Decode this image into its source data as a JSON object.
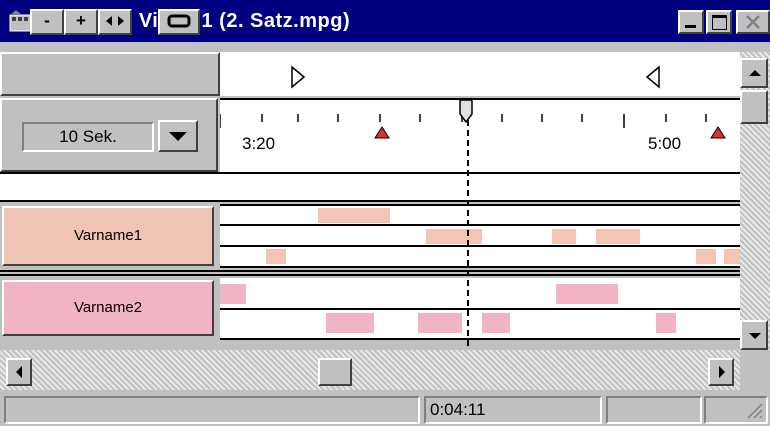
{
  "window": {
    "title": "Timeline Video 1 (2. Satz.mpg)",
    "controls": [
      "minimize-button",
      "maximize-button",
      "close-button"
    ]
  },
  "toolbar": {
    "zoom_out_label": "-",
    "zoom_in_label": "+",
    "fit_label": "◂▸",
    "loop_label": "▭"
  },
  "zoom_select": {
    "value": "10 Sek."
  },
  "ruler": {
    "labels": [
      "3:20",
      "5:00"
    ]
  },
  "tracks": [
    {
      "name": "Varname1"
    },
    {
      "name": "Varname2"
    }
  ],
  "status": {
    "time": "0:04:11"
  },
  "colors": {
    "titlebar": "#000080",
    "track1_label_bg": "#f0c4b4",
    "track2_label_bg": "#f0b4c4",
    "track1_clip": "#f4c4b4",
    "track2_clip": "#f0b4c4",
    "marker": "#e03030"
  }
}
